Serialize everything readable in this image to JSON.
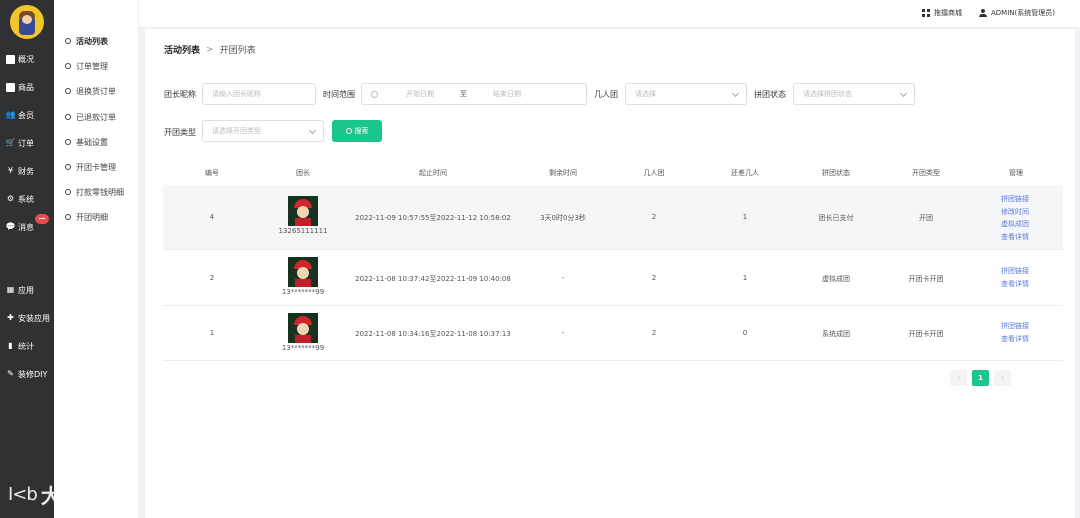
{
  "nav": {
    "items": [
      {
        "label": "概况",
        "icon": "square-icon"
      },
      {
        "label": "商品",
        "icon": "square-icon"
      },
      {
        "label": "会员",
        "icon": "users-icon"
      },
      {
        "label": "订单",
        "icon": "cart-icon"
      },
      {
        "label": "财务",
        "icon": "yen-icon"
      },
      {
        "label": "系统",
        "icon": "gears-icon"
      },
      {
        "label": "消息",
        "icon": "chat-icon"
      },
      {
        "label": "应用",
        "icon": "grid-icon"
      },
      {
        "label": "安装应用",
        "icon": "puzzle-icon"
      },
      {
        "label": "统计",
        "icon": "bar-chart-icon"
      },
      {
        "label": "装修DIY",
        "icon": "brush-icon"
      }
    ]
  },
  "submenu": {
    "items": [
      "活动列表",
      "订单管理",
      "退换货订单",
      "已退款订单",
      "基础设置",
      "开团卡管理",
      "打款零钱明细",
      "开团明细"
    ]
  },
  "topbar": {
    "mall_link": "拖擂商城",
    "user": "ADMIN(系统管理员)"
  },
  "breadcrumb": {
    "parent": "活动列表",
    "separator": ">",
    "current": "开团列表"
  },
  "filters": {
    "leader_label": "团长昵称",
    "leader_placeholder": "请输入团长昵称",
    "time_label": "时间范围",
    "start_placeholder": "开始日期",
    "range_sep": "至",
    "end_placeholder": "结束日期",
    "group_label": "几人团",
    "group_placeholder": "请选择",
    "status_label": "拼团状态",
    "status_placeholder": "请选择拼团状态",
    "type_label": "开团类型",
    "type_placeholder": "请选择开团类型",
    "search_button": "搜索"
  },
  "table": {
    "columns": [
      "编号",
      "团长",
      "起止时间",
      "剩余时间",
      "几人团",
      "还差几人",
      "拼团状态",
      "开团类型",
      "管理"
    ],
    "rows": [
      {
        "id": "4",
        "leader": "13265111111",
        "time": "2022-11-09 10:57:55至2022-11-12 10:58:02",
        "remaining": "3天0时0分3秒",
        "group_size": "2",
        "missing": "1",
        "status": "团长已支付",
        "type": "开团",
        "actions": [
          "拼团链接",
          "修改时间",
          "虚拟成团",
          "查看详情"
        ]
      },
      {
        "id": "2",
        "leader": "13*******99",
        "time": "2022-11-08 10:37:42至2022-11-09 10:40:08",
        "remaining": "-",
        "group_size": "2",
        "missing": "1",
        "status": "虚拟成团",
        "type": "开团卡开团",
        "actions": [
          "拼团链接",
          "查看详情"
        ]
      },
      {
        "id": "1",
        "leader": "13*******99",
        "time": "2022-11-08 10:34:16至2022-11-08 10:37:13",
        "remaining": "-",
        "group_size": "2",
        "missing": "0",
        "status": "系统成团",
        "type": "开团卡开团",
        "actions": [
          "拼团链接",
          "查看详情"
        ]
      }
    ]
  },
  "pagination": {
    "prev": "‹",
    "current": "1",
    "next": "›"
  },
  "watermark": {
    "mark": "I<b",
    "text": "大数跨境"
  }
}
